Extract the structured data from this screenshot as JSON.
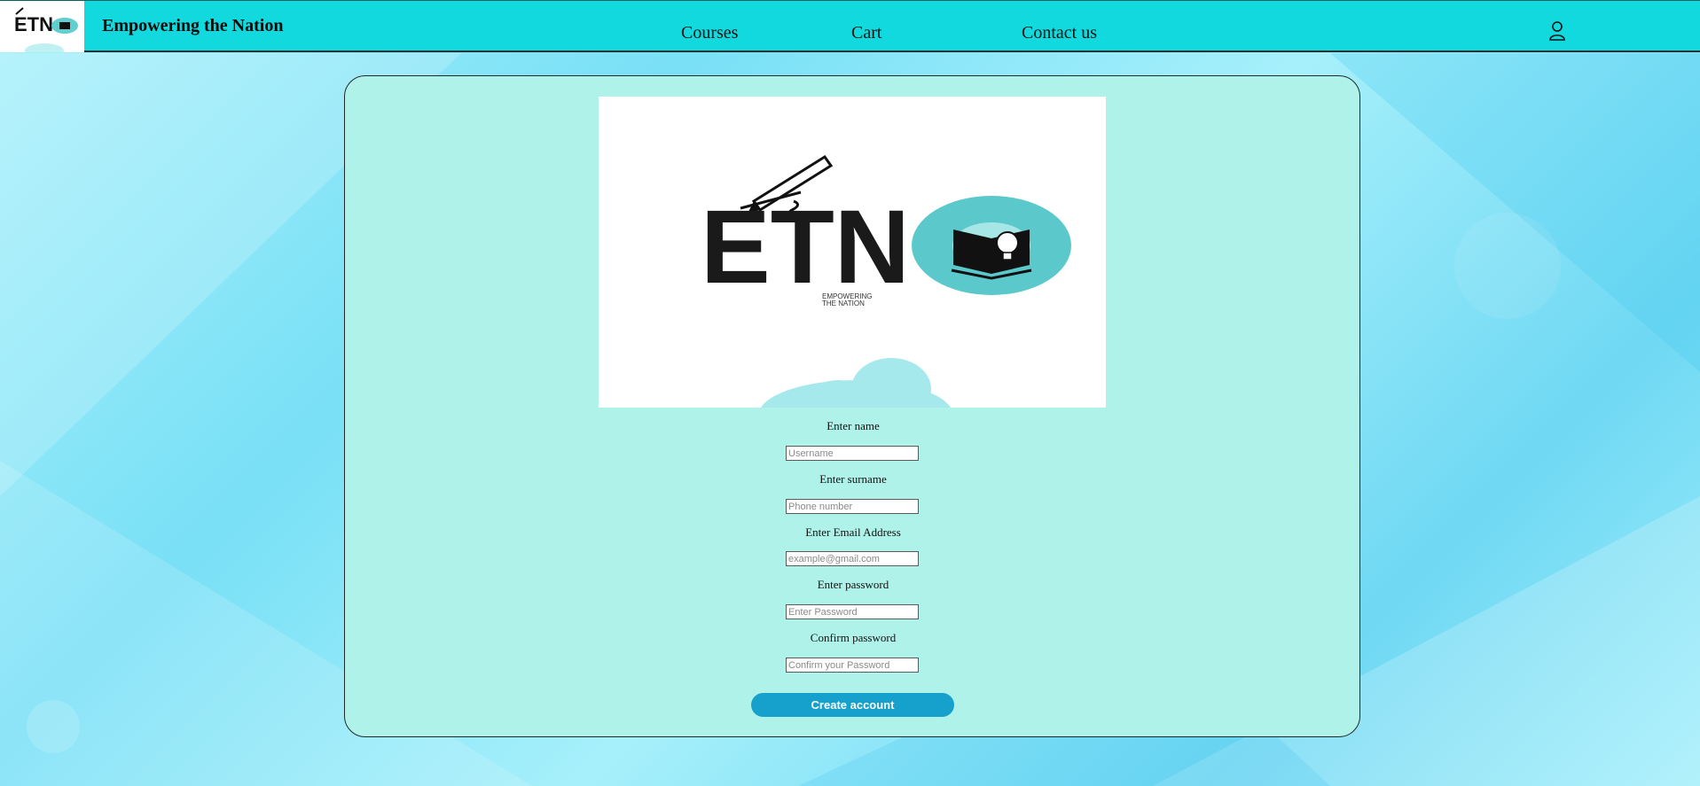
{
  "header": {
    "logo_text": "ETN",
    "title": "Empowering the Nation",
    "nav": [
      {
        "label": "Courses"
      },
      {
        "label": "Cart"
      },
      {
        "label": "Contact us"
      }
    ],
    "user_icon": "user-icon",
    "bg_color": "#12d9dd"
  },
  "hero": {
    "logo_text": "ETN",
    "tagline_1": "EMPOWERING",
    "tagline_2": "THE NATION"
  },
  "form": {
    "fields": [
      {
        "label": "Enter name",
        "placeholder": "Username"
      },
      {
        "label": "Enter surname",
        "placeholder": "Phone number"
      },
      {
        "label": "Enter Email Address",
        "placeholder": "example@gmail.com"
      },
      {
        "label": "Enter password",
        "placeholder": "Enter Password"
      },
      {
        "label": "Confirm password",
        "placeholder": "Confirm your Password"
      }
    ],
    "submit_label": "Create account",
    "card_color": "#aef2ea",
    "button_color": "#16a1cc"
  }
}
